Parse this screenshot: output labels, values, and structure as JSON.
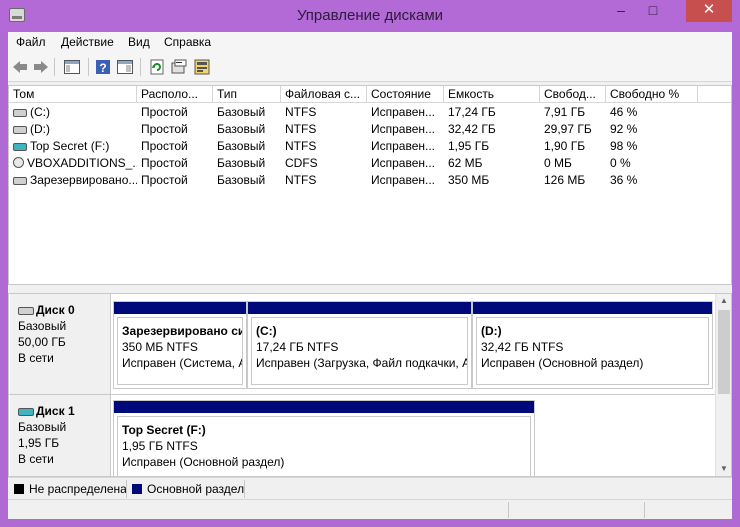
{
  "window": {
    "title": "Управление дисками",
    "minimize_glyph": "–",
    "maximize_glyph": "□",
    "close_glyph": "✕"
  },
  "menu": {
    "items": [
      "Файл",
      "Действие",
      "Вид",
      "Справка"
    ]
  },
  "toolbar": {
    "buttons": [
      "back-icon",
      "forward-icon",
      "console-tree-icon",
      "help-icon",
      "properties-pane-icon",
      "refresh-icon",
      "properties-icon",
      "rescan-icon"
    ]
  },
  "volumes": {
    "columns": [
      "Том",
      "Располо...",
      "Тип",
      "Файловая с...",
      "Состояние",
      "Емкость",
      "Свобод...",
      "Свободно %"
    ],
    "rows": [
      {
        "name": "(C:)",
        "icon": "volume-icon",
        "layout": "Простой",
        "type": "Базовый",
        "fs": "NTFS",
        "status": "Исправен...",
        "capacity": "17,24 ГБ",
        "free": "7,91 ГБ",
        "free_pct": "46 %"
      },
      {
        "name": "(D:)",
        "icon": "volume-icon",
        "layout": "Простой",
        "type": "Базовый",
        "fs": "NTFS",
        "status": "Исправен...",
        "capacity": "32,42 ГБ",
        "free": "29,97 ГБ",
        "free_pct": "92 %"
      },
      {
        "name": "Top Secret (F:)",
        "icon": "removable-volume-icon",
        "layout": "Простой",
        "type": "Базовый",
        "fs": "NTFS",
        "status": "Исправен...",
        "capacity": "1,95 ГБ",
        "free": "1,90 ГБ",
        "free_pct": "98 %"
      },
      {
        "name": "VBOXADDITIONS_...",
        "icon": "cd-icon",
        "layout": "Простой",
        "type": "Базовый",
        "fs": "CDFS",
        "status": "Исправен...",
        "capacity": "62 МБ",
        "free": "0 МБ",
        "free_pct": "0 %"
      },
      {
        "name": "Зарезервировано...",
        "icon": "volume-icon",
        "layout": "Простой",
        "type": "Базовый",
        "fs": "NTFS",
        "status": "Исправен...",
        "capacity": "350 МБ",
        "free": "126 МБ",
        "free_pct": "36 %"
      }
    ]
  },
  "disks": [
    {
      "name": "Диск 0",
      "type": "Базовый",
      "size": "50,00 ГБ",
      "state": "В сети",
      "partitions": [
        {
          "title": "Зарезервировано си",
          "size_fs": "350 МБ NTFS",
          "status": "Исправен (Система, А"
        },
        {
          "title": "(C:)",
          "size_fs": "17,24 ГБ NTFS",
          "status": "Исправен (Загрузка, Файл подкачки, А"
        },
        {
          "title": "(D:)",
          "size_fs": "32,42 ГБ NTFS",
          "status": "Исправен (Основной раздел)"
        }
      ]
    },
    {
      "name": "Диск 1",
      "type": "Базовый",
      "size": "1,95 ГБ",
      "state": "В сети",
      "partitions": [
        {
          "title": "Top Secret  (F:)",
          "size_fs": "1,95 ГБ NTFS",
          "status": "Исправен (Основной раздел)"
        }
      ]
    }
  ],
  "legend": {
    "unallocated": "Не распределена",
    "unallocated_color": "#000000",
    "primary": "Основной раздел",
    "primary_color": "#00097a"
  },
  "scrollbar": {
    "up_glyph": "▲",
    "down_glyph": "▼"
  }
}
